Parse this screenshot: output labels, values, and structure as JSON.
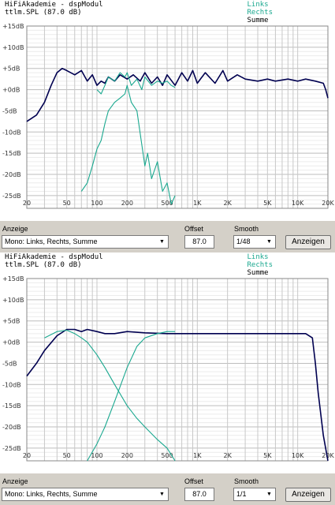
{
  "colors": {
    "summe": "#000050",
    "links": "#1aa88f",
    "rechts": "#1aa88f",
    "grid": "#c8c8c8"
  },
  "y_ticks": [
    "+15dB",
    "+10dB",
    "+5dB",
    "+0dB",
    "-5dB",
    "-10dB",
    "-15dB",
    "-20dB",
    "-25dB"
  ],
  "x_ticks": [
    "20",
    "50",
    "100",
    "200",
    "500",
    "1K",
    "2K",
    "5K",
    "10K",
    "20K"
  ],
  "chart_data": [
    {
      "type": "line",
      "title": "HiFiAkademie - dspModul",
      "subtitle": "ttlm.SPL (87.0 dB)",
      "legend": [
        "Links",
        "Rechts",
        "Summe"
      ],
      "x_scale": "log",
      "xlim": [
        20,
        20000
      ],
      "ylim": [
        -28,
        15
      ],
      "series": [
        {
          "name": "Summe",
          "x": [
            20,
            25,
            30,
            35,
            40,
            45,
            50,
            60,
            70,
            80,
            90,
            100,
            110,
            120,
            130,
            150,
            170,
            200,
            230,
            270,
            300,
            350,
            400,
            450,
            500,
            600,
            700,
            800,
            900,
            1000,
            1200,
            1500,
            1800,
            2000,
            2500,
            3000,
            4000,
            5000,
            6000,
            8000,
            10000,
            12000,
            15000,
            18000,
            19000,
            20000
          ],
          "y": [
            -7.5,
            -6,
            -3,
            1,
            4,
            5,
            4.5,
            3.5,
            4.5,
            2,
            3.5,
            1,
            2,
            1.5,
            3,
            2,
            3.5,
            2.5,
            3.5,
            2,
            4,
            1.5,
            3,
            1,
            3.5,
            1,
            4,
            2,
            4.5,
            1.5,
            4,
            1.5,
            4.5,
            2,
            3.5,
            2.5,
            2,
            2.5,
            2,
            2.5,
            2,
            2.5,
            2,
            1.5,
            0,
            -2
          ]
        },
        {
          "name": "Links",
          "x": [
            100,
            110,
            120,
            130,
            150,
            170,
            190,
            200,
            220,
            250,
            280,
            300,
            350,
            400,
            450,
            500,
            550,
            600
          ],
          "y": [
            0,
            -1,
            1,
            3,
            2,
            4,
            3,
            4,
            1,
            2.5,
            0,
            3,
            1,
            2,
            1.5,
            2,
            1,
            0.5
          ]
        },
        {
          "name": "Rechts",
          "x": [
            70,
            80,
            90,
            100,
            110,
            120,
            130,
            150,
            170,
            190,
            200,
            220,
            250,
            300,
            320,
            350,
            400,
            450,
            500,
            550,
            600
          ],
          "y": [
            -24,
            -22,
            -18,
            -14,
            -12,
            -8,
            -5,
            -3,
            -2,
            -1,
            1,
            -3,
            -5,
            -18,
            -15,
            -21,
            -17,
            -24,
            -22,
            -27,
            -25
          ]
        }
      ]
    },
    {
      "type": "line",
      "title": "HiFiAkademie - dspModul",
      "subtitle": "ttlm.SPL (87.0 dB)",
      "legend": [
        "Links",
        "Rechts",
        "Summe"
      ],
      "x_scale": "log",
      "xlim": [
        20,
        20000
      ],
      "ylim": [
        -28,
        15
      ],
      "series": [
        {
          "name": "Summe",
          "x": [
            20,
            25,
            30,
            40,
            50,
            60,
            70,
            80,
            100,
            120,
            150,
            200,
            300,
            500,
            1000,
            2000,
            5000,
            10000,
            12000,
            14000,
            15000,
            16000,
            18000,
            20000
          ],
          "y": [
            -8,
            -5,
            -2,
            1.5,
            3,
            3,
            2.5,
            3,
            2.5,
            2,
            2,
            2.5,
            2.2,
            2,
            2,
            2,
            2,
            2,
            2,
            1,
            -5,
            -12,
            -22,
            -28
          ]
        },
        {
          "name": "Links",
          "x": [
            30,
            40,
            50,
            60,
            70,
            80,
            100,
            120,
            150,
            200,
            250,
            300,
            400,
            500,
            600
          ],
          "y": [
            1,
            2.5,
            2.8,
            2,
            1,
            0,
            -3,
            -6,
            -10,
            -15,
            -18,
            -20,
            -23,
            -25,
            -28
          ]
        },
        {
          "name": "Rechts",
          "x": [
            80,
            100,
            120,
            150,
            200,
            250,
            300,
            400,
            500,
            600
          ],
          "y": [
            -28,
            -24,
            -20,
            -14,
            -6,
            -1,
            1,
            2,
            2.5,
            2.5
          ]
        }
      ]
    }
  ],
  "controls": [
    {
      "anzeige_label": "Anzeige",
      "anzeige_value": "Mono: Links, Rechts, Summe",
      "offset_label": "Offset",
      "offset_value": "87.0",
      "smooth_label": "Smooth",
      "smooth_value": "1/48",
      "button": "Anzeigen"
    },
    {
      "anzeige_label": "Anzeige",
      "anzeige_value": "Mono: Links, Rechts, Summe",
      "offset_label": "Offset",
      "offset_value": "87.0",
      "smooth_label": "Smooth",
      "smooth_value": "1/1",
      "button": "Anzeigen"
    }
  ]
}
